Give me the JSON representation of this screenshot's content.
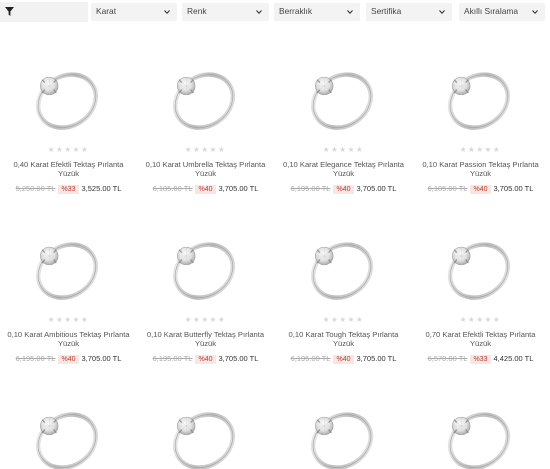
{
  "filters": {
    "karat": "Karat",
    "renk": "Renk",
    "berraklik": "Berraklık",
    "sertifika": "Sertifika",
    "sort": "Akıllı Sıralama"
  },
  "colors": {
    "discount_bg": "#f6e6e4",
    "discount_text": "#c0392b",
    "filter_bg": "#f3f3f3"
  },
  "products": [
    {
      "name": "0,40 Karat Efektli Tektaş Pırlanta Yüzük",
      "old_price": "5,250.00 TL",
      "discount": "%33",
      "price": "3,525.00 TL",
      "stars": "★★★★★"
    },
    {
      "name": "0,10 Karat Umbrella Tektaş Pırlanta Yüzük",
      "old_price": "6,185.00 TL",
      "discount": "%40",
      "price": "3,705.00 TL",
      "stars": "★★★★★"
    },
    {
      "name": "0,10 Karat Elegance Tektaş Pırlanta Yüzük",
      "old_price": "6,195.00 TL",
      "discount": "%40",
      "price": "3,705.00 TL",
      "stars": "★★★★★"
    },
    {
      "name": "0,10 Karat Passion Tektaş Pırlanta Yüzük",
      "old_price": "6,185.00 TL",
      "discount": "%40",
      "price": "3,705.00 TL",
      "stars": "★★★★★"
    },
    {
      "name": "0,10 Karat Ambitious Tektaş Pırlanta Yüzük",
      "old_price": "6,195.00 TL",
      "discount": "%40",
      "price": "3,705.00 TL",
      "stars": "★★★★★"
    },
    {
      "name": "0,10 Karat Butterfly Tektaş Pırlanta Yüzük",
      "old_price": "6,195.00 TL",
      "discount": "%40",
      "price": "3,705.00 TL",
      "stars": "★★★★★"
    },
    {
      "name": "0,10 Karat Tough Tektaş Pırlanta Yüzük",
      "old_price": "6,195.00 TL",
      "discount": "%40",
      "price": "3,705.00 TL",
      "stars": "★★★★★"
    },
    {
      "name": "0,70 Karat Efektli Tektaş Pırlanta Yüzük",
      "old_price": "6,570.00 TL",
      "discount": "%33",
      "price": "4,425.00 TL",
      "stars": "★★★★★"
    }
  ]
}
